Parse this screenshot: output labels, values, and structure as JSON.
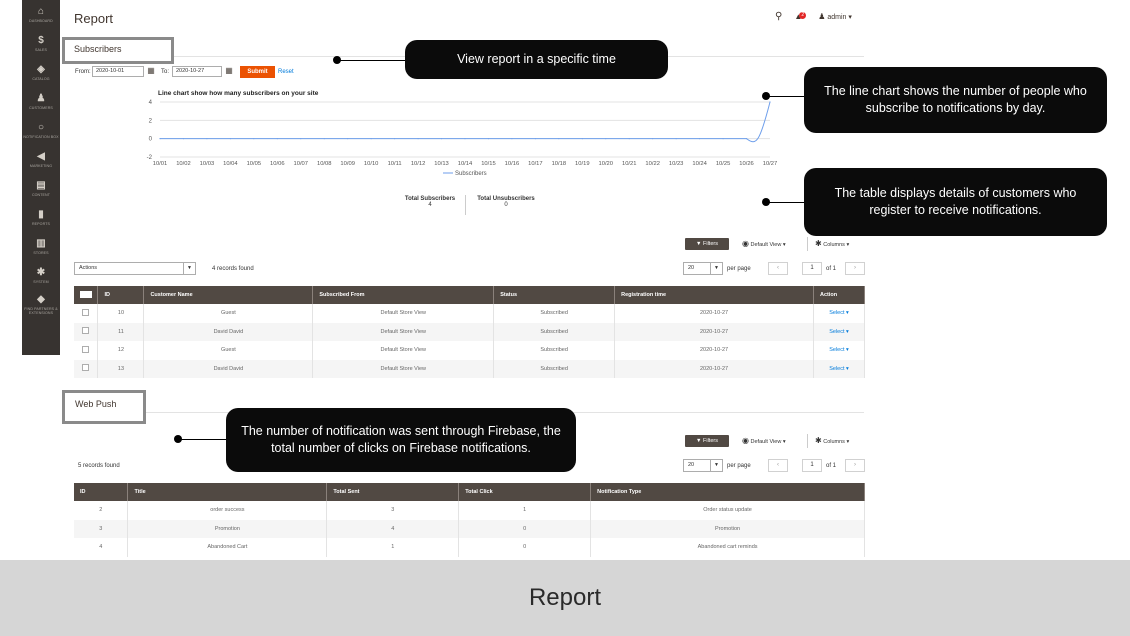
{
  "sidebar": {
    "items": [
      {
        "icon": "dashboard-icon",
        "glyph": "⌂",
        "label": "DASHBOARD"
      },
      {
        "icon": "dollar-icon",
        "glyph": "$",
        "label": "SALES"
      },
      {
        "icon": "catalog-icon",
        "glyph": "◈",
        "label": "CATALOG"
      },
      {
        "icon": "customers-icon",
        "glyph": "♟",
        "label": "CUSTOMERS"
      },
      {
        "icon": "notification-box-icon",
        "glyph": "○",
        "label": "NOTIFICATION BOX"
      },
      {
        "icon": "marketing-icon",
        "glyph": "◀",
        "label": "MARKETING"
      },
      {
        "icon": "content-icon",
        "glyph": "▤",
        "label": "CONTENT"
      },
      {
        "icon": "reports-icon",
        "glyph": "▮",
        "label": "REPORTS"
      },
      {
        "icon": "stores-icon",
        "glyph": "▥",
        "label": "STORES"
      },
      {
        "icon": "system-icon",
        "glyph": "✱",
        "label": "SYSTEM"
      },
      {
        "icon": "extensions-icon",
        "glyph": "◆",
        "label": "FIND PARTNERS & EXTENSIONS"
      }
    ]
  },
  "header": {
    "title": "Report",
    "notification_count": "2",
    "user": "admin ▾"
  },
  "subscribers": {
    "section_label": "Subscribers",
    "from_label": "From:",
    "from_value": "2020-10-01",
    "to_label": "To:",
    "to_value": "2020-10-27",
    "submit": "Submit",
    "reset": "Reset",
    "total_subscribers_label": "Total Subscribers",
    "total_subscribers_value": "4",
    "total_unsubscribers_label": "Total Unsubscribers",
    "total_unsubscribers_value": "0"
  },
  "chart_data": {
    "type": "line",
    "title": "Line chart show how many subscribers on your site",
    "categories": [
      "10/01",
      "10/02",
      "10/03",
      "10/04",
      "10/05",
      "10/06",
      "10/07",
      "10/08",
      "10/09",
      "10/10",
      "10/11",
      "10/12",
      "10/13",
      "10/14",
      "10/15",
      "10/16",
      "10/17",
      "10/18",
      "10/19",
      "10/20",
      "10/21",
      "10/22",
      "10/23",
      "10/24",
      "10/25",
      "10/26",
      "10/27"
    ],
    "series": [
      {
        "name": "Subscribers",
        "values": [
          0,
          0,
          0,
          0,
          0,
          0,
          0,
          0,
          0,
          0,
          0,
          0,
          0,
          0,
          0,
          0,
          0,
          0,
          0,
          0,
          0,
          0,
          0,
          0,
          0,
          0,
          4
        ]
      }
    ],
    "y_ticks": [
      4,
      2,
      0,
      -2
    ],
    "ylim": [
      -2,
      4
    ],
    "grid": true,
    "legend": "bottom",
    "line_color": "#6d9eeb"
  },
  "toolbar": {
    "filters": "Filters",
    "default_view": "Default View ▾",
    "columns": "Columns ▾",
    "actions": "Actions",
    "records_found": "4 records found",
    "per_page_value": "20",
    "per_page_label": "per page",
    "page": "1",
    "of_pages": "of 1"
  },
  "subscribers_table": {
    "headers": [
      "",
      "ID",
      "Customer Name",
      "Subscribed From",
      "Status",
      "Registration time",
      "Action"
    ],
    "rows": [
      [
        "10",
        "Guest",
        "Default Store View",
        "Subscribed",
        "2020-10-27",
        "Select ▾"
      ],
      [
        "11",
        "David David",
        "Default Store View",
        "Subscribed",
        "2020-10-27",
        "Select ▾"
      ],
      [
        "12",
        "Guest",
        "Default Store View",
        "Subscribed",
        "2020-10-27",
        "Select ▾"
      ],
      [
        "13",
        "David David",
        "Default Store View",
        "Subscribed",
        "2020-10-27",
        "Select ▾"
      ]
    ]
  },
  "webpush": {
    "section_label": "Web Push",
    "records_found": "5 records found",
    "filters": "Filters",
    "default_view": "Default View ▾",
    "columns": "Columns ▾",
    "per_page_value": "20",
    "per_page_label": "per page",
    "page": "1",
    "of_pages": "of 1"
  },
  "webpush_table": {
    "headers": [
      "ID",
      "Title",
      "Total Sent",
      "Total Click",
      "Notification Type"
    ],
    "rows": [
      [
        "2",
        "order success",
        "3",
        "1",
        "Order status update"
      ],
      [
        "3",
        "Promotion",
        "4",
        "0",
        "Promotion"
      ],
      [
        "4",
        "Abandoned Cart",
        "1",
        "0",
        "Abandoned cart reminds"
      ]
    ]
  },
  "callouts": {
    "time": "View report in a specific time",
    "chart": "The line chart shows the number of people who subscribe to notifications by day.",
    "table": "The table displays details of customers who register to receive notifications.",
    "firebase": "The number of notification was sent through Firebase, the total number of clicks on Firebase notifications."
  },
  "caption": "Report"
}
